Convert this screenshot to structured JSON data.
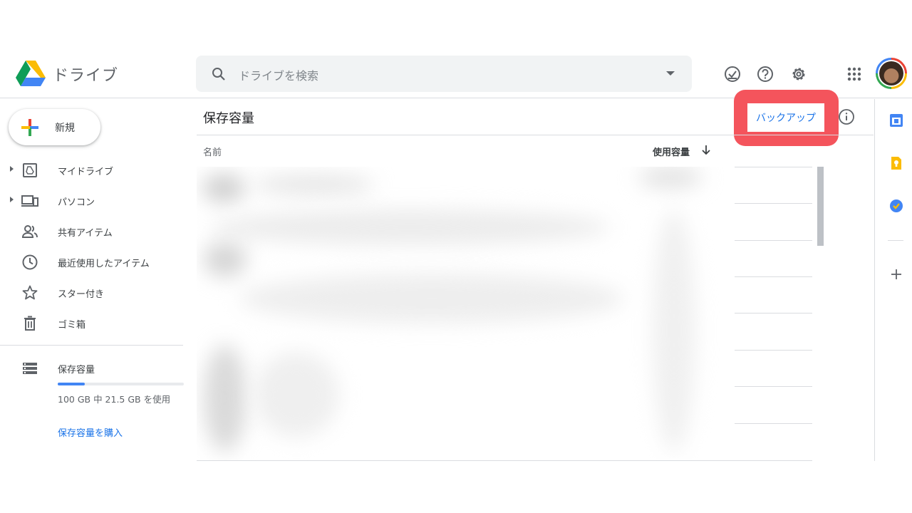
{
  "app": {
    "title": "ドライブ"
  },
  "search": {
    "placeholder": "ドライブを検索"
  },
  "header_icons": [
    "offline-ready-icon",
    "help-icon",
    "settings-icon",
    "apps-grid-icon"
  ],
  "new_button": {
    "label": "新規"
  },
  "sidebar": {
    "items": [
      {
        "label": "マイドライブ",
        "icon": "my-drive-icon",
        "expandable": true
      },
      {
        "label": "パソコン",
        "icon": "computers-icon",
        "expandable": true
      },
      {
        "label": "共有アイテム",
        "icon": "shared-icon",
        "expandable": false
      },
      {
        "label": "最近使用したアイテム",
        "icon": "recent-icon",
        "expandable": false
      },
      {
        "label": "スター付き",
        "icon": "star-icon",
        "expandable": false
      },
      {
        "label": "ゴミ箱",
        "icon": "trash-icon",
        "expandable": false
      }
    ],
    "storage": {
      "label": "保存容量",
      "usage_text": "100 GB 中 21.5 GB を使用",
      "used_fraction": 0.215,
      "buy_link": "保存容量を購入"
    }
  },
  "main": {
    "title": "保存容量",
    "backup_button": "バックアップ",
    "columns": {
      "name": "名前",
      "usage": "使用容量"
    }
  },
  "side_panel": {
    "apps": [
      "calendar-icon",
      "keep-icon",
      "tasks-icon"
    ]
  },
  "colors": {
    "accent": "#1a73e8",
    "highlight": "#f4545c",
    "storage_fill": "#4285f4"
  }
}
